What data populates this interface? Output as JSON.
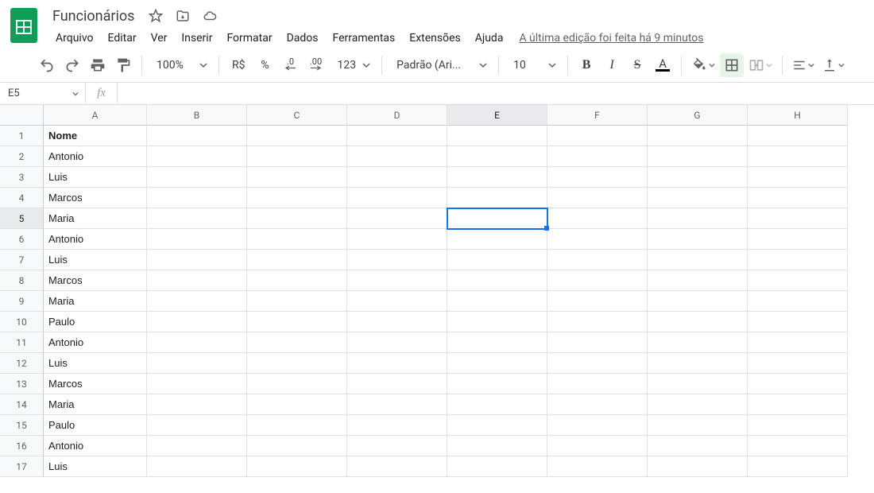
{
  "header": {
    "title": "Funcionários",
    "last_edit": "A última edição foi feita há 9 minutos"
  },
  "menu": {
    "items": [
      "Arquivo",
      "Editar",
      "Ver",
      "Inserir",
      "Formatar",
      "Dados",
      "Ferramentas",
      "Extensões",
      "Ajuda"
    ]
  },
  "toolbar": {
    "zoom": "100%",
    "currency": "R$",
    "percent": "%",
    "dec_dec": ".0",
    "inc_dec": ".00",
    "more_formats": "123",
    "font": "Padrão (Ari...",
    "font_size": "10",
    "bold": "B",
    "italic": "I",
    "strike": "S",
    "text_color_letter": "A"
  },
  "fx": {
    "name_box": "E5",
    "fx_label": "fx",
    "formula": ""
  },
  "grid": {
    "columns": [
      "A",
      "B",
      "C",
      "D",
      "E",
      "F",
      "G",
      "H"
    ],
    "selected_col": "E",
    "selected_row": 5,
    "rows": [
      {
        "n": 1,
        "a": "Nome",
        "bold": true
      },
      {
        "n": 2,
        "a": "Antonio"
      },
      {
        "n": 3,
        "a": "Luis"
      },
      {
        "n": 4,
        "a": "Marcos"
      },
      {
        "n": 5,
        "a": "Maria"
      },
      {
        "n": 6,
        "a": "Antonio"
      },
      {
        "n": 7,
        "a": "Luis"
      },
      {
        "n": 8,
        "a": "Marcos"
      },
      {
        "n": 9,
        "a": "Maria"
      },
      {
        "n": 10,
        "a": "Paulo"
      },
      {
        "n": 11,
        "a": "Antonio"
      },
      {
        "n": 12,
        "a": "Luis"
      },
      {
        "n": 13,
        "a": "Marcos"
      },
      {
        "n": 14,
        "a": "Maria"
      },
      {
        "n": 15,
        "a": "Paulo"
      },
      {
        "n": 16,
        "a": "Antonio"
      },
      {
        "n": 17,
        "a": "Luis"
      }
    ]
  }
}
